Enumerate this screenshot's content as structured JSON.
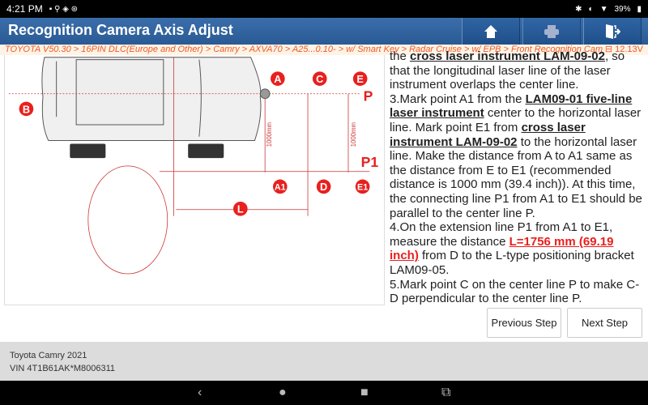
{
  "status": {
    "time": "4:21 PM",
    "battery": "39%"
  },
  "header": {
    "title": "Recognition Camera Axis Adjust",
    "buttons": [
      {
        "icon": "home-icon"
      },
      {
        "icon": "print-icon"
      },
      {
        "icon": "exit-icon"
      }
    ]
  },
  "breadcrumb": {
    "path": "TOYOTA V50.30 > 16PIN DLC(Europe and Other) > Camry > AXVA70 > A25...0.10- > w/ Smart Key > Radar Cruise > w/ EPB > Front Recognition Camera",
    "voltage": "12.13V"
  },
  "diagram": {
    "labels": {
      "a": "A",
      "b": "B",
      "c": "C",
      "d": "D",
      "e": "E",
      "a1": "A1",
      "e1": "E1",
      "l": "L",
      "p": "P",
      "p1": "P1",
      "dist1": "1000mm",
      "dist2": "1000mm"
    }
  },
  "instructions": {
    "p1": [
      "the ",
      "cross laser instrument LAM-09-02",
      ", so that the longitudinal laser line of the laser instrument overlaps the center line."
    ],
    "p2": [
      "3.Mark point A1 from the ",
      "LAM09-01 five-line laser instrument",
      " center to the horizontal laser line. Mark point E1 from ",
      "cross laser instrument LAM-09-02",
      " to the horizontal laser line. Make the distance from A to A1 same as the distance from E to E1 (recommended distance is 1000 mm (39.4 inch)). At this time, the connecting line P1 from A1 to E1 should be parallel to the center line P."
    ],
    "p3": [
      "4.On the extension line P1 from A1 to E1, measure the distance ",
      "L=1756 mm (69.19 inch)",
      " from D to the L-type positioning bracket LAM09-05."
    ],
    "p4": "5.Mark point C on the center line P to make C-D perpendicular to the center line P."
  },
  "buttons": {
    "previous": "Previous Step",
    "next": "Next Step"
  },
  "footer": {
    "vehicle": "Toyota Camry 2021",
    "vin": "VIN 4T1B61AK*M8006311"
  },
  "colors": {
    "header": "#2d62a0",
    "accent": "#e8201e",
    "breadcrumb": "#ee5a24"
  }
}
